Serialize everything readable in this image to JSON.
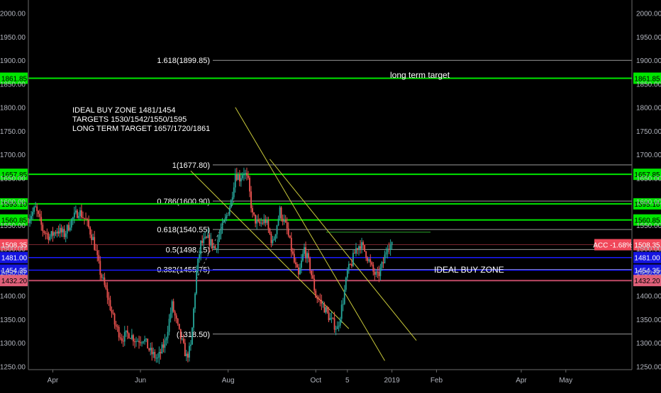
{
  "chart_data": {
    "type": "candlestick",
    "y_axis": {
      "range": [
        1243,
        2028
      ],
      "ticks": [
        1250,
        1300,
        1350,
        1400,
        1450,
        1500,
        1550,
        1600,
        1650,
        1700,
        1750,
        1800,
        1850,
        1900,
        1950,
        2000
      ],
      "tick_labels": [
        "1250.00",
        "1300.00",
        "1350.00",
        "1400.00",
        "1450.00",
        "1500.00",
        "1550.00",
        "1600.00",
        "1650.00",
        "1700.00",
        "1750.00",
        "1800.00",
        "1850.00",
        "1900.00",
        "1950.00",
        "2000.00"
      ],
      "both_sides": true
    },
    "x_axis": {
      "tick_labels": [
        "Apr",
        "Jun",
        "Aug",
        "Oct",
        "5",
        "2019",
        "Feb",
        "Apr",
        "May"
      ],
      "range_days": [
        0,
        420
      ]
    },
    "x_ticks_days": [
      17,
      78,
      139,
      200,
      222,
      253,
      284,
      343,
      374
    ],
    "grid": false,
    "price_badges": [
      {
        "value": 1861.85,
        "label": "1861.85",
        "color": "#00e600",
        "text_color": "#000000"
      },
      {
        "value": 1657.85,
        "label": "1657.85",
        "color": "#00e600",
        "text_color": "#000000"
      },
      {
        "value": 1595.1,
        "label": "1595.10",
        "color": "#00e600",
        "text_color": "#000000"
      },
      {
        "value": 1560.85,
        "label": "1560.85",
        "color": "#00e600",
        "text_color": "#000000"
      },
      {
        "value": 1508.35,
        "label": "1508.35",
        "color": "#f0485a",
        "text_color": "#ffffff"
      },
      {
        "value": 1481.0,
        "label": "1481.00",
        "color": "#1515e0",
        "text_color": "#ffffff"
      },
      {
        "value": 1454.35,
        "label": "1454.35",
        "color": "#1515e0",
        "text_color": "#ffffff"
      },
      {
        "value": 1432.2,
        "label": "1432.20",
        "color": "#e0607a",
        "text_color": "#000000"
      }
    ],
    "acc_badge": {
      "label": "ACC -1.68%",
      "value": 1508.35,
      "color": "#f0485a"
    },
    "fib_levels": [
      {
        "label": "1.618(1899.85)",
        "value": 1899.85
      },
      {
        "label": "1(1677.80)",
        "value": 1677.8
      },
      {
        "label": "0.786(1600.90)",
        "value": 1600.9
      },
      {
        "label": "0.618(1540.55)",
        "value": 1540.55
      },
      {
        "label": "0.5(1498.15)",
        "value": 1498.15
      },
      {
        "label": "0.382(1455.75)",
        "value": 1455.75
      },
      {
        "label": "(1318.50)",
        "value": 1318.5
      }
    ],
    "fib_x_days": [
      120,
      405
    ],
    "trend_lines": [
      {
        "x": [
          144,
          248
        ],
        "y": [
          1800,
          1262
        ]
      },
      {
        "x": [
          113,
          223
        ],
        "y": [
          1665,
          1330
        ]
      },
      {
        "x": [
          168,
          270
        ],
        "y": [
          1690,
          1305
        ]
      }
    ],
    "dashed_line": {
      "x": [
        117,
        143
      ],
      "y": [
        1435,
        1600
      ]
    },
    "annotations": {
      "note_lines": [
        "IDEAL BUY ZONE 1481/1454",
        "TARGETS 1530/1542/1550/1595",
        "LONG TERM TARGET 1657/1720/1861"
      ],
      "long_term": "long term target",
      "buy_zone": "IDEAL BUY ZONE"
    },
    "series_key_points": {
      "days": [
        0,
        5,
        10,
        15,
        20,
        25,
        30,
        35,
        40,
        45,
        50,
        55,
        60,
        65,
        70,
        75,
        80,
        85,
        90,
        95,
        100,
        105,
        110,
        113,
        117,
        120,
        125,
        130,
        133,
        137,
        141,
        144,
        147,
        150,
        153,
        156,
        160,
        165,
        170,
        175,
        180,
        185,
        188,
        192,
        196,
        200,
        205,
        210,
        215,
        219,
        222,
        225,
        228,
        231,
        235,
        240,
        243,
        247,
        250,
        253
      ],
      "values": [
        1565,
        1585,
        1540,
        1525,
        1540,
        1530,
        1560,
        1580,
        1560,
        1520,
        1450,
        1400,
        1340,
        1310,
        1320,
        1305,
        1310,
        1280,
        1265,
        1300,
        1380,
        1320,
        1270,
        1290,
        1450,
        1510,
        1520,
        1500,
        1530,
        1560,
        1600,
        1660,
        1650,
        1665,
        1640,
        1570,
        1550,
        1560,
        1510,
        1580,
        1540,
        1470,
        1440,
        1500,
        1460,
        1400,
        1380,
        1350,
        1330,
        1390,
        1450,
        1470,
        1500,
        1510,
        1490,
        1450,
        1440,
        1470,
        1510,
        1505
      ]
    }
  }
}
